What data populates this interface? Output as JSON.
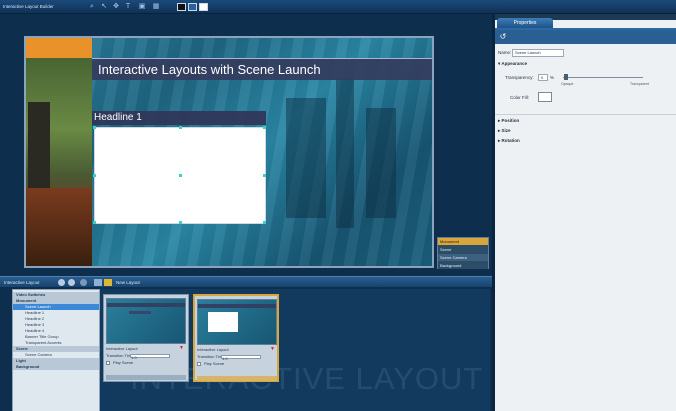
{
  "app": {
    "title": "Interactive Layout Builder"
  },
  "toolbar": {
    "icons": [
      "zoom-icon",
      "pointer-icon",
      "move-icon",
      "text-icon",
      "image-icon",
      "grid-icon"
    ],
    "swatch_colors": [
      "#111111",
      "#2e5f9e",
      "#ffffff"
    ]
  },
  "preview": {
    "title": "Interactive Layouts with Scene Launch",
    "headline": "Headline 1"
  },
  "scene_panel": {
    "items": [
      {
        "label": "Monument",
        "color": "#d9a63c"
      },
      {
        "label": "Scene",
        "color": "#2c4c68"
      },
      {
        "label": "Scene Camera",
        "color": "#3c6080"
      },
      {
        "label": "Background",
        "color": "#2c4c68"
      }
    ]
  },
  "bottom_toolbar": {
    "label": "Interactive Layout",
    "new_layout_label": "New Layout"
  },
  "layout_tree": {
    "items": [
      {
        "label": "Video Switches",
        "level": 0,
        "selected": false
      },
      {
        "label": "Monument",
        "level": 0,
        "selected": false
      },
      {
        "label": "Scene Launch",
        "level": 1,
        "selected": true
      },
      {
        "label": "Headline 1",
        "level": 1,
        "selected": false
      },
      {
        "label": "Headline 2",
        "level": 1,
        "selected": false
      },
      {
        "label": "Headline 3",
        "level": 1,
        "selected": false
      },
      {
        "label": "Headline 4",
        "level": 1,
        "selected": false
      },
      {
        "label": "Banner Title Group",
        "level": 1,
        "selected": false
      },
      {
        "label": "Transparent Accents",
        "level": 1,
        "selected": false
      },
      {
        "label": "Scene",
        "level": 0,
        "selected": false
      },
      {
        "label": "Scene Camera",
        "level": 1,
        "selected": false
      },
      {
        "label": "Light",
        "level": 0,
        "selected": false
      },
      {
        "label": "Background",
        "level": 0,
        "selected": false
      }
    ]
  },
  "thumbnails": {
    "watermark": "INTERACTIVE LAYOUT",
    "cards": [
      {
        "name": "Interactive Layout",
        "transition_label": "Transition Time",
        "transition_value": "1.0",
        "play_label": "Play Scene"
      },
      {
        "name": "Interactive Layout",
        "transition_label": "Transition Time",
        "transition_value": "1.0",
        "play_label": "Play Scene"
      }
    ]
  },
  "properties": {
    "tab_label": "Properties",
    "name_label": "Name:",
    "name_value": "Scene Launch",
    "appearance_label": "Appearance",
    "transparency_label": "Transparency:",
    "transparency_value": "0",
    "transparency_unit": "%",
    "slider_min_label": "Opaque",
    "slider_max_label": "Transparent",
    "slider_value": 0.04,
    "color_fill_label": "Color Fill:",
    "color_fill_value": "#ffffff",
    "sections": [
      "Position",
      "Size",
      "Rotation"
    ]
  }
}
